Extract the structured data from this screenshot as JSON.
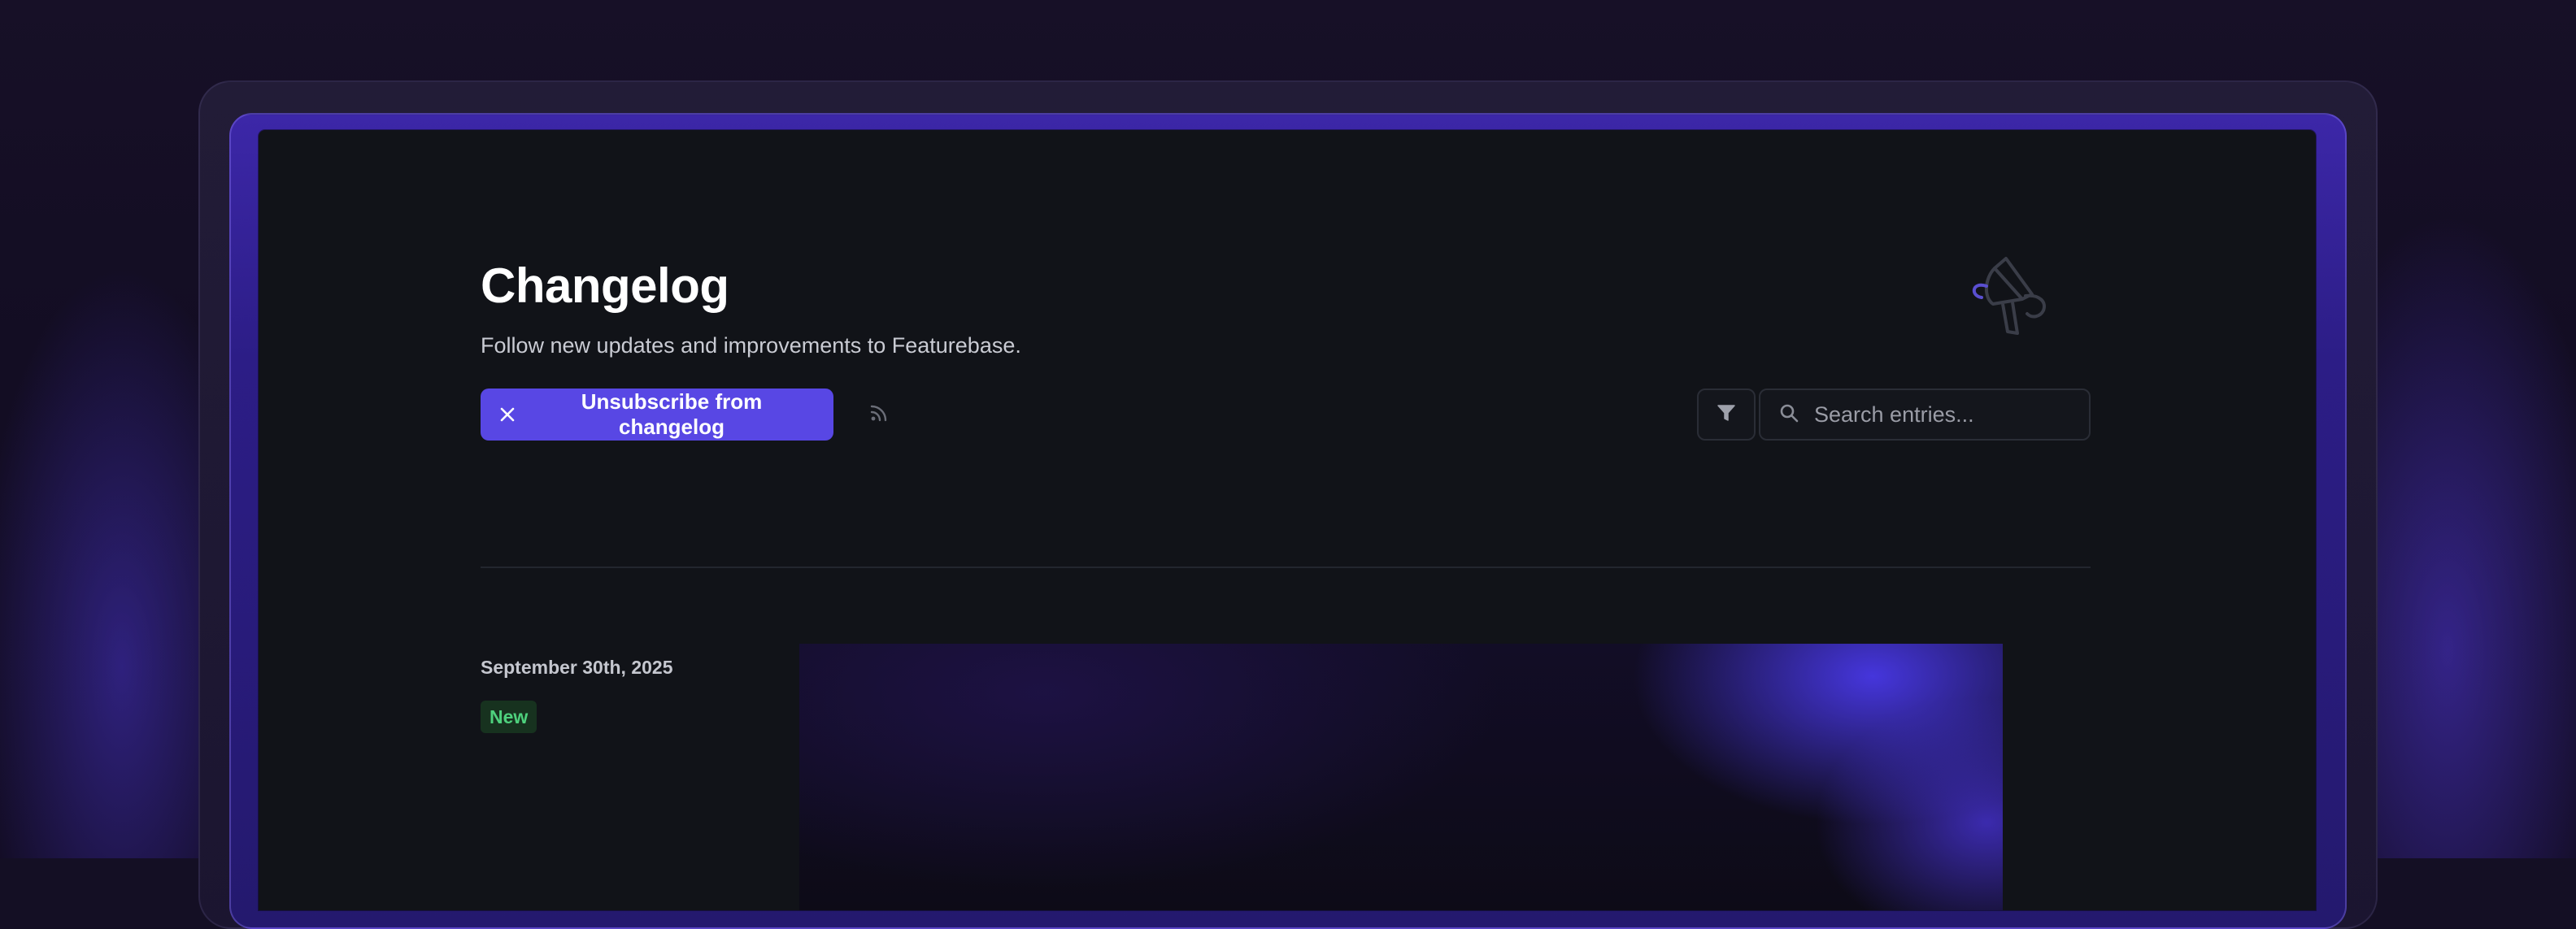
{
  "header": {
    "title": "Changelog",
    "subtitle": "Follow new updates and improvements to Featurebase."
  },
  "actions": {
    "unsubscribe_label": "Unsubscribe from changelog",
    "search_placeholder": "Search entries..."
  },
  "entry": {
    "date": "September 30th, 2025",
    "badge": "New"
  },
  "colors": {
    "accent": "#5847e4",
    "badge_text": "#4ed17d",
    "badge_bg": "#17321f",
    "background": "#111318"
  },
  "icons": [
    "close-icon",
    "rss-icon",
    "megaphone-icon",
    "filter-icon",
    "search-icon"
  ]
}
